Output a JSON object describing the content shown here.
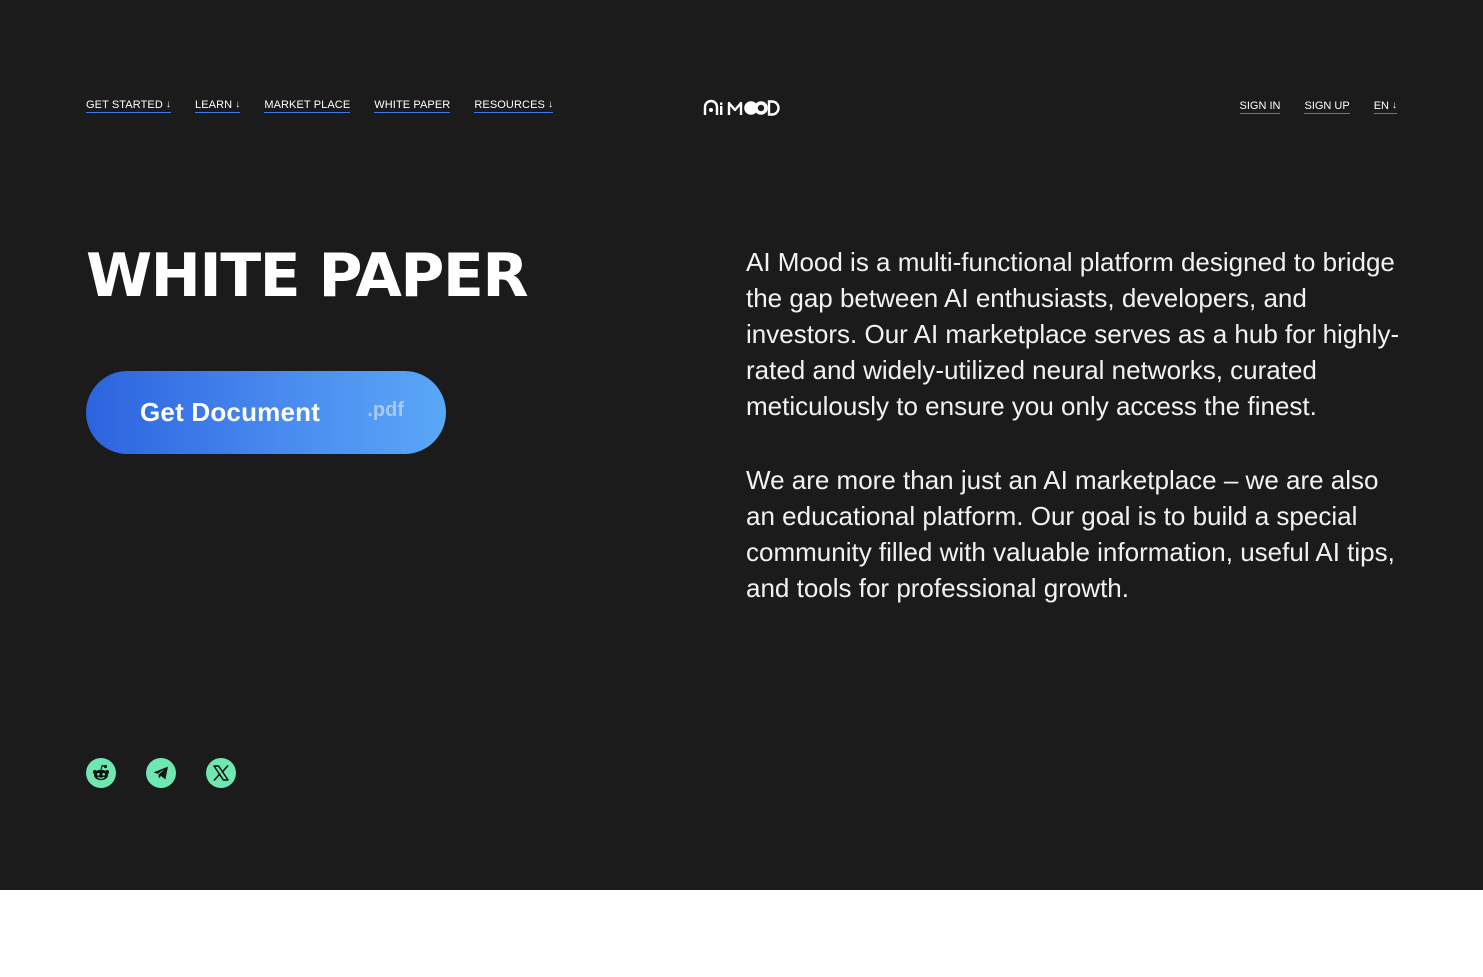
{
  "nav": {
    "left": [
      {
        "label": "GET STARTED",
        "arrow": "↓"
      },
      {
        "label": "LEARN",
        "arrow": "↓"
      },
      {
        "label": "MARKET PLACE",
        "arrow": ""
      },
      {
        "label": "WHITE PAPER",
        "arrow": ""
      },
      {
        "label": "RESOURCES",
        "arrow": "↓"
      }
    ],
    "right": [
      {
        "label": "SIGN IN",
        "arrow": ""
      },
      {
        "label": "SIGN UP",
        "arrow": ""
      },
      {
        "label": "EN",
        "arrow": "↓"
      }
    ]
  },
  "logo": {
    "text": "AiMOOD"
  },
  "hero": {
    "title": "WHITE PAPER",
    "cta_label": "Get Document",
    "cta_ext": ".pdf"
  },
  "description": {
    "p1": "AI Mood is a multi-functional platform designed to bridge the gap between AI enthusiasts, developers, and investors. Our AI marketplace serves as a hub for highly-rated and widely-utilized neural networks, curated meticulously to ensure you only access the finest.",
    "p2": "We are more than just an AI marketplace – we are also an educational platform. Our goal is to build a special community filled with valuable information, useful AI tips, and tools for professional growth."
  },
  "socials": [
    {
      "icon": "reddit-icon"
    },
    {
      "icon": "telegram-icon"
    },
    {
      "icon": "x-icon"
    }
  ],
  "colors": {
    "background": "#1b1b1c",
    "accent": "#3d7be8",
    "social": "#6ee7b1"
  }
}
